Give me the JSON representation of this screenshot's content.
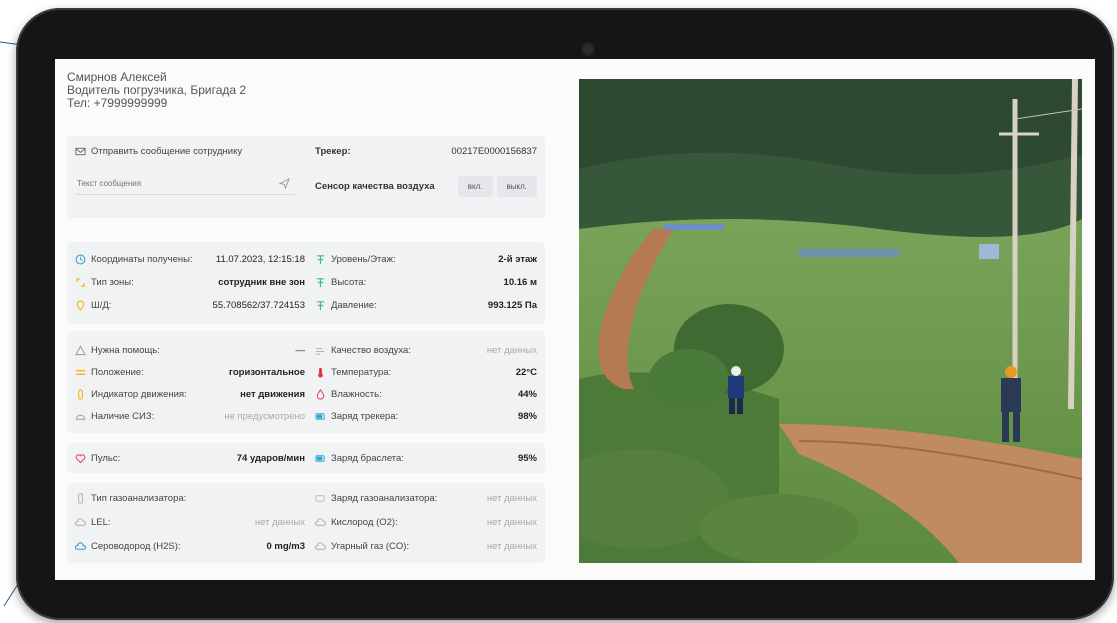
{
  "profile": {
    "name": "Смирнов Алексей",
    "role": "Водитель погрузчика, Бригада 2",
    "phone": "Тел: +7999999999"
  },
  "message": {
    "send_label": "Отправить сообщение сотруднику",
    "placeholder": "Текст сообщения"
  },
  "tracker": {
    "label": "Трекер:",
    "value": "00217E0000156837"
  },
  "air_sensor": {
    "label": "Сенсор качества воздуха",
    "on": "вкл.",
    "off": "выкл."
  },
  "coords": {
    "received_label": "Координаты получены:",
    "received_value": "11.07.2023, 12:15:18",
    "zone_label": "Тип зоны:",
    "zone_value": "сотрудник вне зон",
    "latlon_label": "Ш/Д:",
    "latlon_value": "55.708562/37.724153",
    "level_label": "Уровень/Этаж:",
    "level_value": "2-й этаж",
    "height_label": "Высота:",
    "height_value": "10.16 м",
    "pressure_label": "Давление:",
    "pressure_value": "993.125 Па"
  },
  "status": {
    "help_label": "Нужна помощь:",
    "help_value": "—",
    "position_label": "Положение:",
    "position_value": "горизонтальное",
    "motion_label": "Индикатор движения:",
    "motion_value": "нет движения",
    "ppe_label": "Наличие СИЗ:",
    "ppe_value": "не предусмотрено",
    "air_label": "Качество воздуха:",
    "air_value": "нет данных",
    "temp_label": "Температура:",
    "temp_value": "22°C",
    "humidity_label": "Влажность:",
    "humidity_value": "44%",
    "tracker_charge_label": "Заряд трекера:",
    "tracker_charge_value": "98%"
  },
  "pulse": {
    "label": "Пульс:",
    "value": "74 ударов/мин",
    "bracelet_label": "Заряд браслета:",
    "bracelet_value": "95%"
  },
  "gas": {
    "type_label": "Тип газоанализатора:",
    "charge_label": "Заряд газоанализатора:",
    "charge_value": "нет данных",
    "lel_label": "LEL:",
    "lel_value": "нет данных",
    "o2_label": "Кислород (O2):",
    "o2_value": "нет данных",
    "h2s_label": "Сероводород (H2S):",
    "h2s_value": "0 mg/m3",
    "co_label": "Угарный газ (CO):",
    "co_value": "нет данных"
  },
  "photo": {
    "icon": "field-workers-photo"
  },
  "colors": {
    "accent": "#2aa7c9",
    "warning": "#f2b705",
    "danger": "#e04b5a",
    "alarm_red": "#e0303a",
    "bezel": "#151517",
    "panel": "#f1f2f4"
  }
}
